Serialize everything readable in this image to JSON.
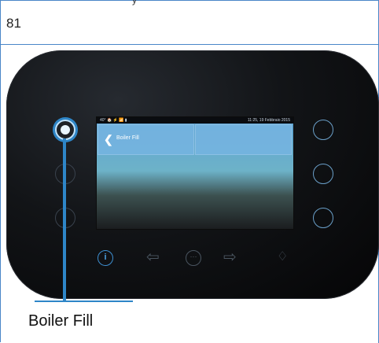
{
  "page_number": "81",
  "header_fragment": "y",
  "device": {
    "status_bar": {
      "left_text": "40° 🏠  ⚡  📶 ▮",
      "datetime": "11:25, 19 Febbraio 2015"
    },
    "tile": {
      "back_glyph": "❮",
      "label": "Boiler Fill"
    },
    "nav": {
      "info": "i",
      "back_arrow": "⇦",
      "more": "···",
      "forward_arrow": "⇨",
      "drop": "♢"
    }
  },
  "callout_label": "Boiler Fill",
  "colors": {
    "accent": "#2e86c8",
    "ring": "#6a9fc8",
    "screen_top": "#5fa3d6"
  },
  "icons": {
    "info": "info-icon",
    "back": "arrow-left-icon",
    "more": "more-icon",
    "forward": "arrow-right-icon",
    "drop": "water-drop-icon"
  }
}
